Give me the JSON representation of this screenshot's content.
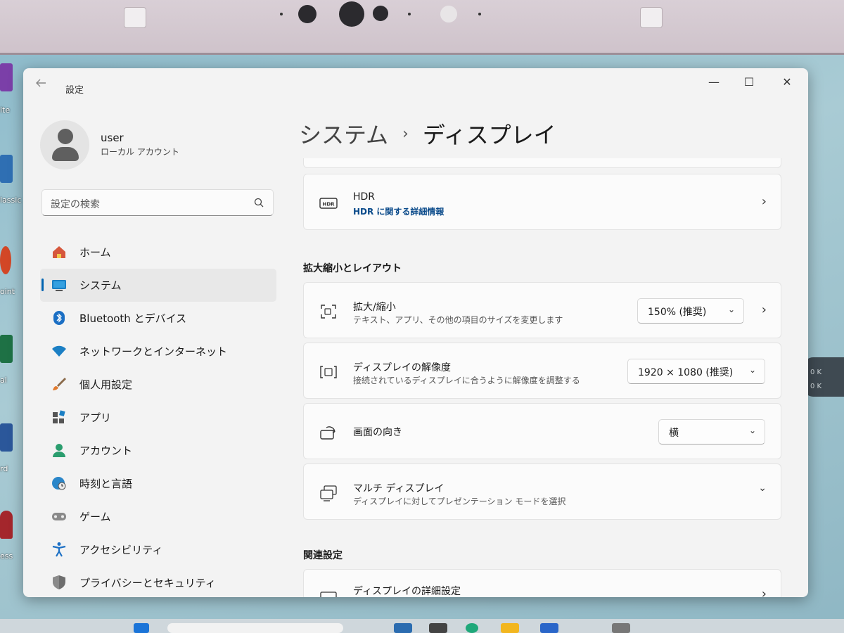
{
  "window": {
    "app_title": "設定",
    "controls": {
      "minimize": "—",
      "maximize": "☐",
      "close": "✕"
    }
  },
  "user": {
    "name": "user",
    "account_type": "ローカル アカウント"
  },
  "search": {
    "placeholder": "設定の検索"
  },
  "sidebar": {
    "items": [
      {
        "label": "ホーム",
        "icon": "home-icon"
      },
      {
        "label": "システム",
        "icon": "system-icon",
        "active": true
      },
      {
        "label": "Bluetooth とデバイス",
        "icon": "bluetooth-icon"
      },
      {
        "label": "ネットワークとインターネット",
        "icon": "wifi-icon"
      },
      {
        "label": "個人用設定",
        "icon": "brush-icon"
      },
      {
        "label": "アプリ",
        "icon": "apps-icon"
      },
      {
        "label": "アカウント",
        "icon": "account-icon"
      },
      {
        "label": "時刻と言語",
        "icon": "globe-clock-icon"
      },
      {
        "label": "ゲーム",
        "icon": "gamepad-icon"
      },
      {
        "label": "アクセシビリティ",
        "icon": "accessibility-icon"
      },
      {
        "label": "プライバシーとセキュリティ",
        "icon": "shield-icon"
      }
    ]
  },
  "breadcrumb": {
    "parent": "システム",
    "separator": "›",
    "current": "ディスプレイ"
  },
  "hdr": {
    "title": "HDR",
    "link": "HDR に関する詳細情報",
    "icon": "hdr-icon"
  },
  "sections": {
    "scale_layout": "拡大縮小とレイアウト",
    "related": "関連設定"
  },
  "scale": {
    "title": "拡大/縮小",
    "subtitle": "テキスト、アプリ、その他の項目のサイズを変更します",
    "value": "150% (推奨)"
  },
  "resolution": {
    "title": "ディスプレイの解像度",
    "subtitle": "接続されているディスプレイに合うように解像度を調整する",
    "value": "1920 × 1080 (推奨)"
  },
  "orientation": {
    "title": "画面の向き",
    "value": "横"
  },
  "multi_display": {
    "title": "マルチ ディスプレイ",
    "subtitle": "ディスプレイに対してプレゼンテーション モードを選択"
  },
  "advanced_display": {
    "title": "ディスプレイの詳細設定"
  },
  "desktop": {
    "labels": [
      "ite",
      "lassic",
      "oint",
      "al",
      "rd",
      "ess"
    ],
    "tray": [
      "0 K",
      "0 K"
    ]
  },
  "colors": {
    "accent": "#0063b1",
    "link": "#0a4a8a",
    "window_bg": "#f3f3f3",
    "card_bg": "#fbfbfb"
  }
}
